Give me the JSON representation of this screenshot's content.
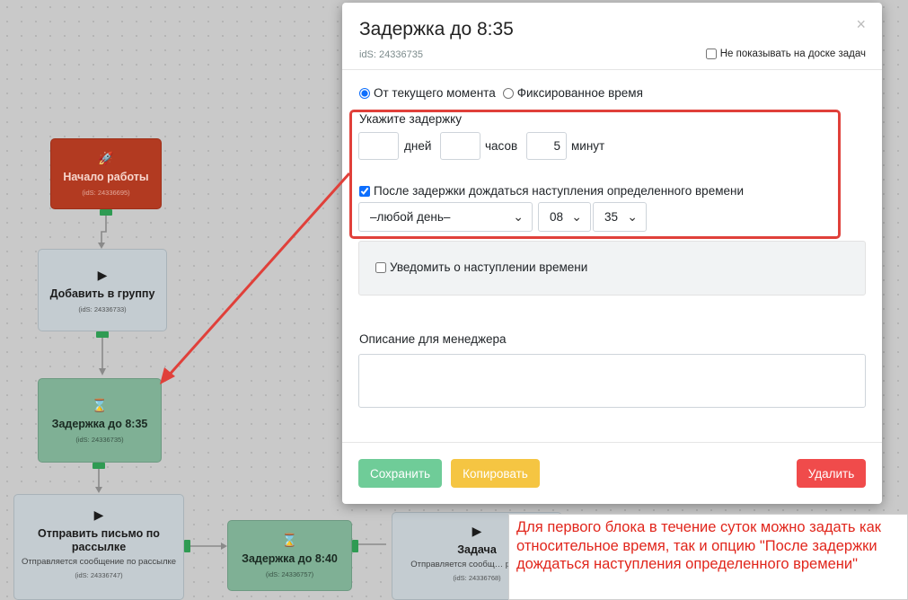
{
  "canvas": {
    "nodes": [
      {
        "title": "Начало работы",
        "sub": "",
        "ids": "(idS: 24336695)",
        "icon": "rocket-icon"
      },
      {
        "title": "Добавить в группу",
        "sub": "",
        "ids": "(idS: 24336733)",
        "icon": "play-icon"
      },
      {
        "title": "Задержка до 8:35",
        "sub": "",
        "ids": "(idS: 24336735)",
        "icon": "hourglass-icon"
      },
      {
        "title": "Отправить письмо по рассылке",
        "sub": "Отправляется сообщение по рассылке",
        "ids": "(idS: 24336747)",
        "icon": "play-icon"
      },
      {
        "title": "Задержка до 8:40",
        "sub": "",
        "ids": "(idS: 24336757)",
        "icon": "hourglass-icon"
      },
      {
        "title": "Задача",
        "sub": "Отправляется сообщ… рассылке",
        "ids": "(idS: 24336768)",
        "icon": "play-icon"
      }
    ]
  },
  "modal": {
    "title": "Задержка до 8:35",
    "ids": "idS: 24336735",
    "hide_board_label": "Не показывать на доске задач",
    "mode_relative": "От текущего момента",
    "mode_fixed": "Фиксированное время",
    "delay_label": "Укажите задержку",
    "days_value": "",
    "days_unit": "дней",
    "hours_value": "",
    "hours_unit": "часов",
    "minutes_value": "5",
    "minutes_unit": "минут",
    "after_delay_label": "После задержки дождаться наступления определенного времени",
    "day_select": "–любой день–",
    "hour_select": "08",
    "minute_select": "35",
    "notify_label": "Уведомить о наступлении времени",
    "desc_label": "Описание для менеджера",
    "desc_value": "",
    "save_label": "Сохранить",
    "copy_label": "Копировать",
    "delete_label": "Удалить"
  },
  "annotation": {
    "text": "Для первого блока в течение суток можно задать как относительное время, так и опцию \"После задержки дождаться наступления определенного времени\""
  },
  "colors": {
    "start_node": "#b23a21",
    "gray_node": "#c4ccd1",
    "green_node": "#7fb095",
    "port": "#2f9b53",
    "highlight": "#e0403a",
    "save": "#6fcc98",
    "copy": "#f5c542",
    "delete": "#f04b4b",
    "annotation_text": "#e1261c"
  }
}
